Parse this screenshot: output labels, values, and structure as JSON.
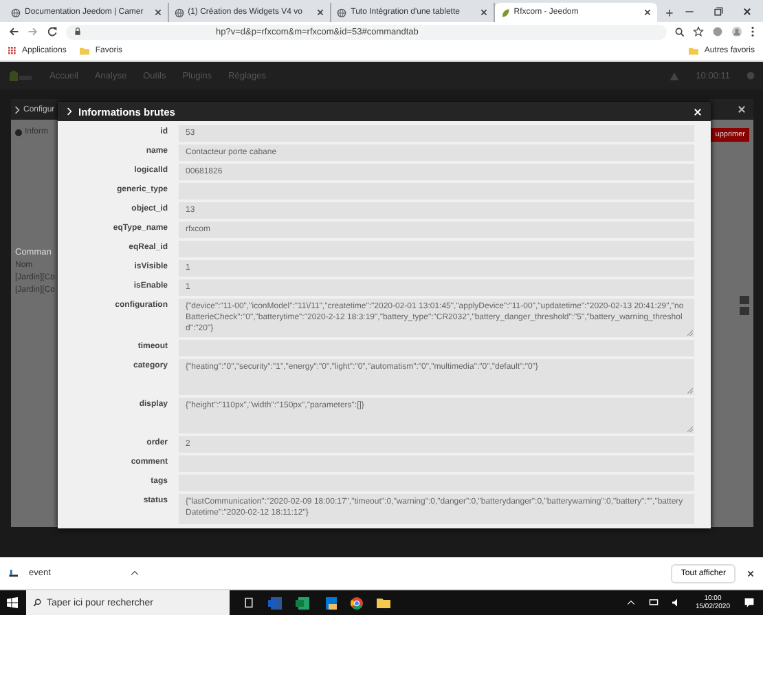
{
  "browser": {
    "tabs": [
      {
        "title": "Documentation Jeedom | Camer",
        "selected": false
      },
      {
        "title": "(1) Création des Widgets V4 vo",
        "selected": false
      },
      {
        "title": "Tuto Intégration d'une tablette",
        "selected": false
      },
      {
        "title": "Rfxcom - Jeedom",
        "selected": true
      }
    ],
    "url": "hp?v=d&p=rfxcom&m=rfxcom&id=53#commandtab",
    "bookmarks": [
      "Applications",
      "Favoris"
    ],
    "other_bookmarks": "Autres favoris"
  },
  "nav": {
    "items": [
      "Accueil",
      "Analyse",
      "Outils",
      "Plugins",
      "Réglages"
    ],
    "time": "10:00:11"
  },
  "back_modal": {
    "title": "Configur",
    "tab": "Inform",
    "delete_button": "upprimer",
    "section": "Comman",
    "column": "Nom",
    "rows": [
      "[Jardin][Co",
      "[Jardin][Co"
    ]
  },
  "modal": {
    "title": "Informations brutes",
    "fields": [
      {
        "label": "id",
        "value": "53",
        "kind": "input"
      },
      {
        "label": "name",
        "value": "Contacteur porte cabane",
        "kind": "input"
      },
      {
        "label": "logicalId",
        "value": "00681826",
        "kind": "input"
      },
      {
        "label": "generic_type",
        "kind": "input"
      },
      {
        "label": "object_id",
        "value": "13",
        "kind": "input"
      },
      {
        "label": "eqType_name",
        "value": "rfxcom",
        "kind": "input"
      },
      {
        "label": "eqReal_id",
        "kind": "input"
      },
      {
        "label": "isVisible",
        "value": "1",
        "kind": "input"
      },
      {
        "label": "isEnable",
        "value": "1",
        "kind": "input"
      },
      {
        "label": "configuration",
        "value": "{\"device\":\"11-00\",\"iconModel\":\"11\\/11\",\"createtime\":\"2020-02-01 13:01:45\",\"applyDevice\":\"11-00\",\"updatetime\":\"2020-02-13 20:41:29\",\"noBatterieCheck\":\"0\",\"batterytime\":\"2020-2-12 18:3:19\",\"battery_type\":\"CR2032\",\"battery_danger_threshold\":\"5\",\"battery_warning_threshold\":\"20\"}",
        "kind": "textarea"
      },
      {
        "label": "timeout",
        "kind": "input"
      },
      {
        "label": "category",
        "value": "{\"heating\":\"0\",\"security\":\"1\",\"energy\":\"0\",\"light\":\"0\",\"automatism\":\"0\",\"multimedia\":\"0\",\"default\":\"0\"}",
        "kind": "textarea"
      },
      {
        "label": "display",
        "value": "{\"height\":\"110px\",\"width\":\"150px\",\"parameters\":[]}",
        "kind": "textarea"
      },
      {
        "label": "order",
        "value": "2",
        "kind": "input"
      },
      {
        "label": "comment",
        "kind": "input"
      },
      {
        "label": "tags",
        "kind": "input"
      },
      {
        "label": "status",
        "value": "{\"lastCommunication\":\"2020-02-09 18:00:17\",\"timeout\":0,\"warning\":0,\"danger\":0,\"batterydanger\":0,\"batterywarning\":0,\"battery\":\"\",\"batteryDatetime\":\"2020-02-12 18:11:12\"}",
        "kind": "status"
      }
    ]
  },
  "downloads": {
    "file": "event",
    "show_all_button": "Tout afficher"
  },
  "taskbar": {
    "search_placeholder": "Taper ici pour rechercher",
    "time": "10:00",
    "date": "15/02/2020"
  }
}
